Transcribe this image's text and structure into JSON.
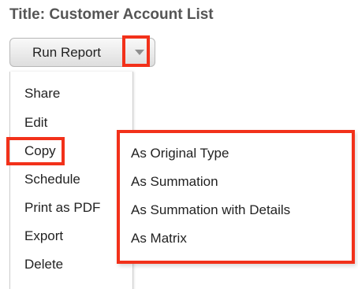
{
  "report": {
    "title": "Title: Customer Account List"
  },
  "toolbar": {
    "run_report_label": "Run Report",
    "dropdown_icon": "chevron-down-icon"
  },
  "actions_menu": {
    "items": [
      {
        "label": "Share"
      },
      {
        "label": "Edit"
      },
      {
        "label": "Copy"
      },
      {
        "label": "Schedule"
      },
      {
        "label": "Print as PDF"
      },
      {
        "label": "Export"
      },
      {
        "label": "Delete"
      }
    ]
  },
  "copy_submenu": {
    "items": [
      {
        "label": "As Original Type"
      },
      {
        "label": "As Summation"
      },
      {
        "label": "As Summation with Details"
      },
      {
        "label": "As Matrix"
      }
    ]
  },
  "colors": {
    "highlight": "#f2311a",
    "title_text": "#555555",
    "menu_text": "#222222"
  }
}
